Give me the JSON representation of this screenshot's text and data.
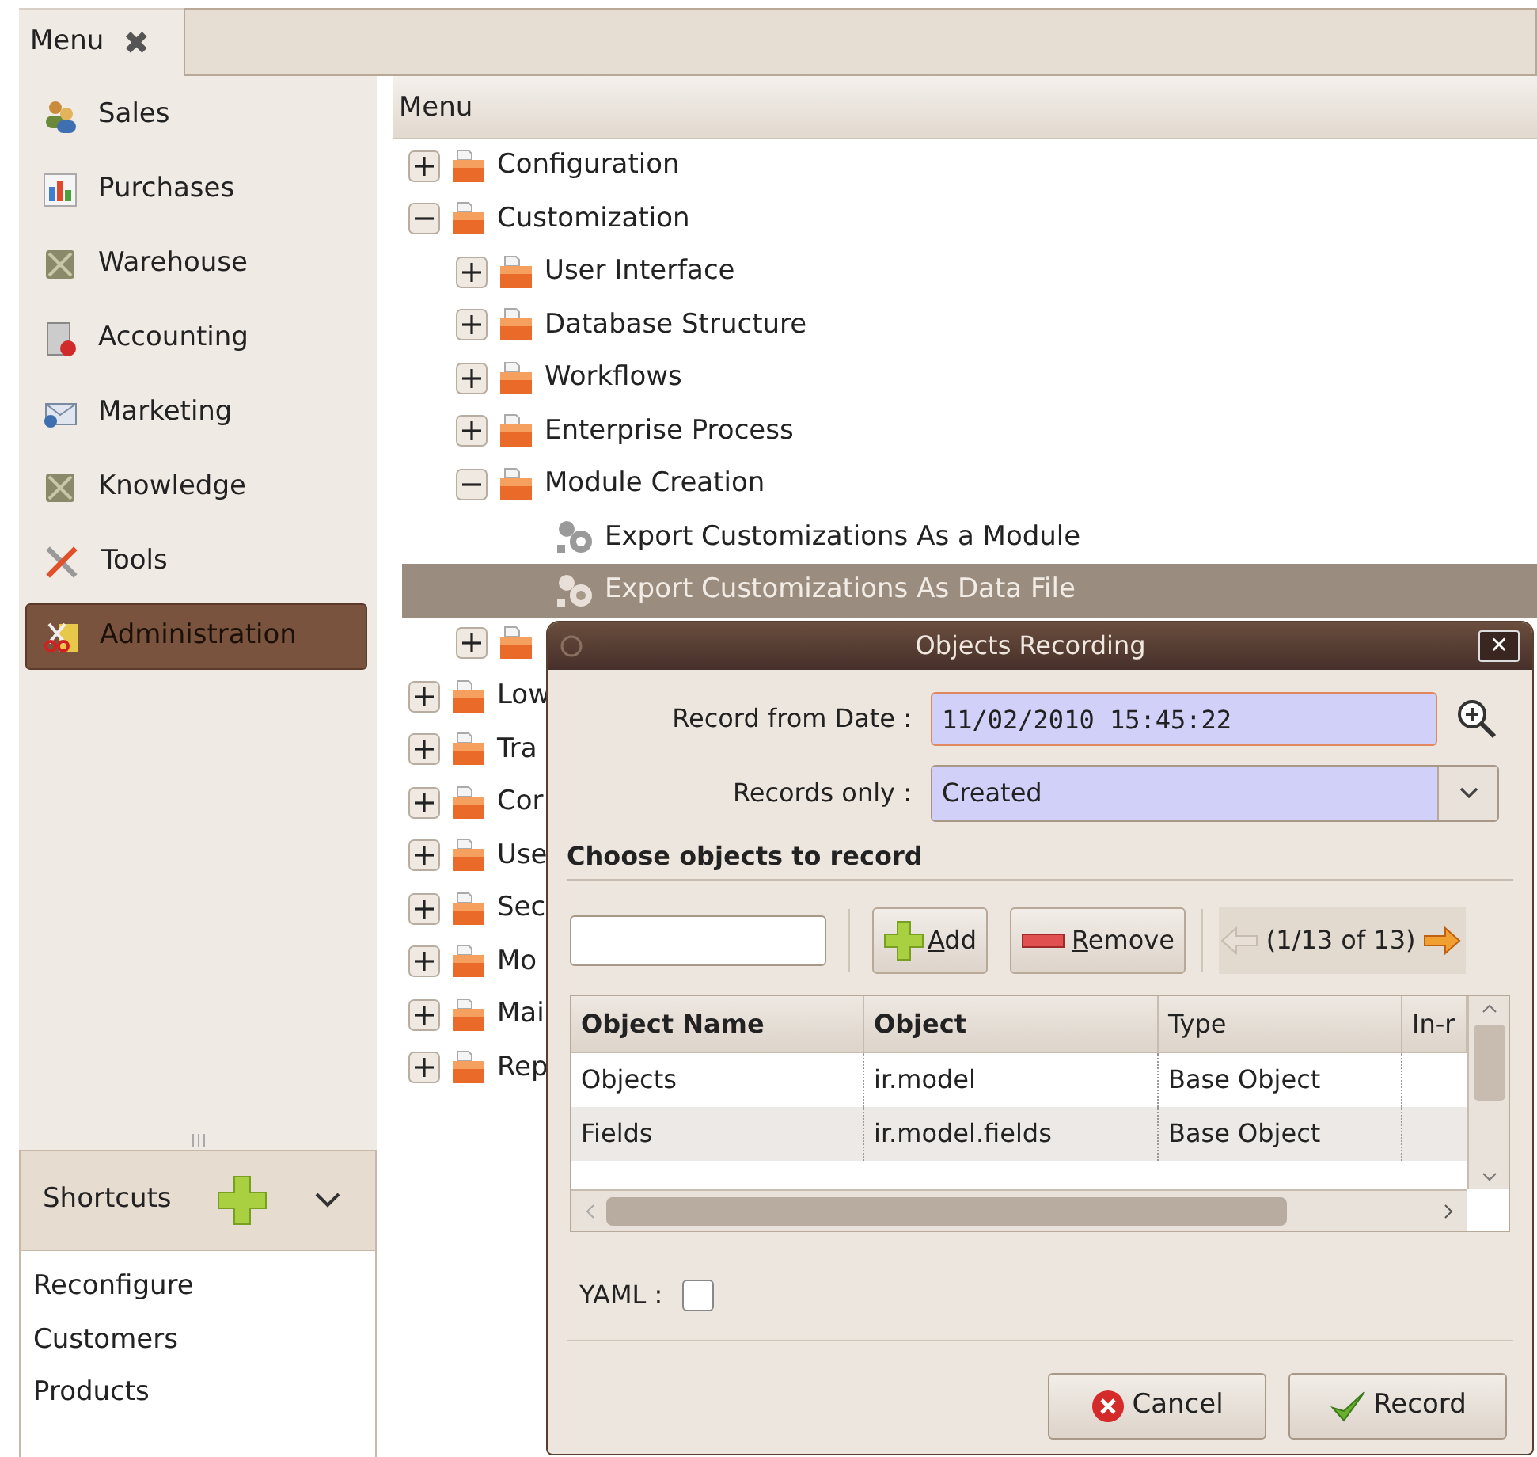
{
  "tab": {
    "label": "Menu",
    "close": "✖"
  },
  "sidebar": {
    "items": [
      {
        "label": "Sales",
        "selected": false
      },
      {
        "label": "Purchases",
        "selected": false
      },
      {
        "label": "Warehouse",
        "selected": false
      },
      {
        "label": "Accounting",
        "selected": false
      },
      {
        "label": "Marketing",
        "selected": false
      },
      {
        "label": "Knowledge",
        "selected": false
      },
      {
        "label": "Tools",
        "selected": false
      },
      {
        "label": "Administration",
        "selected": true
      }
    ]
  },
  "shortcuts": {
    "title": "Shortcuts",
    "items": [
      "Reconfigure",
      "Customers",
      "Products"
    ]
  },
  "tree": {
    "header": "Menu",
    "items": [
      {
        "label": "Configuration",
        "kind": "folder",
        "expanded": false
      },
      {
        "label": "Customization",
        "kind": "folder",
        "expanded": true,
        "children": [
          {
            "label": "User Interface",
            "kind": "folder",
            "expanded": false
          },
          {
            "label": "Database Structure",
            "kind": "folder",
            "expanded": false
          },
          {
            "label": "Workflows",
            "kind": "folder",
            "expanded": false
          },
          {
            "label": "Enterprise Process",
            "kind": "folder",
            "expanded": false
          },
          {
            "label": "Module Creation",
            "kind": "folder",
            "expanded": true,
            "children": [
              {
                "label": "Export Customizations As a Module",
                "kind": "action",
                "selected": false
              },
              {
                "label": "Export Customizations As Data File",
                "kind": "action",
                "selected": true
              }
            ]
          },
          {
            "kind": "folder",
            "expanded": false
          }
        ]
      },
      {
        "label": "Low",
        "kind": "folder",
        "expanded": false
      },
      {
        "label": "Tra",
        "kind": "folder",
        "expanded": false
      },
      {
        "label": "Cor",
        "kind": "folder",
        "expanded": false
      },
      {
        "label": "Use",
        "kind": "folder",
        "expanded": false
      },
      {
        "label": "Sec",
        "kind": "folder",
        "expanded": false
      },
      {
        "label": "Mo",
        "kind": "folder",
        "expanded": false
      },
      {
        "label": "Mai",
        "kind": "folder",
        "expanded": false
      },
      {
        "label": "Rep",
        "kind": "folder",
        "expanded": false
      }
    ]
  },
  "dialog": {
    "title": "Objects Recording",
    "close": "✕",
    "record_from_date": {
      "label": "Record from Date :",
      "value": "11/02/2010 15:45:22"
    },
    "records_only": {
      "label": "Records only :",
      "value": "Created"
    },
    "section": "Choose objects to record",
    "add": {
      "label": "Add",
      "underline_first": true
    },
    "remove": {
      "label": "Remove",
      "underline_first": true
    },
    "pager": "(1/13 of 13)",
    "table": {
      "columns": [
        "Object Name",
        "Object",
        "Type",
        "In-r"
      ],
      "rows": [
        [
          "Objects",
          "ir.model",
          "Base Object"
        ],
        [
          "Fields",
          "ir.model.fields",
          "Base Object"
        ]
      ]
    },
    "yaml": {
      "label": "YAML :",
      "checked": false
    },
    "buttons": [
      {
        "label": "Cancel",
        "kind": "cancel"
      },
      {
        "label": "Record",
        "kind": "ok"
      }
    ]
  }
}
